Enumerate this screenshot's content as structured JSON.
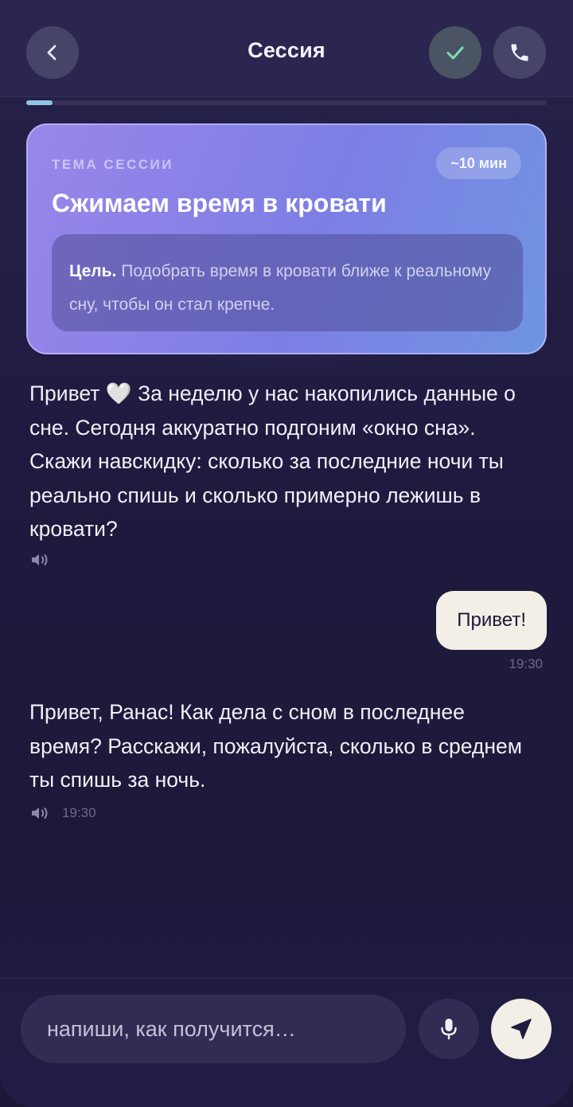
{
  "header": {
    "title": "Сессия",
    "back_icon": "chevron-left-icon",
    "done_icon": "check-icon",
    "call_icon": "phone-icon",
    "done_icon_color": "#7ee0b0"
  },
  "progress": {
    "value": 0.05,
    "color": "#8fc6e6"
  },
  "topic": {
    "label": "ТЕМА СЕССИИ",
    "duration": "~10 мин",
    "title": "Сжимаем время в кровати",
    "goal_label": "Цель.",
    "goal_text": "Подобрать время в кровати ближе к реальному сну, чтобы он стал крепче."
  },
  "messages": [
    {
      "from": "bot",
      "text_before_emoji": "Привет",
      "emoji": "🤍",
      "text_after_emoji": "За неделю у нас накопились данные о сне. Сегодня аккуратно подгоним «окно сна». Скажи навскидку: сколько за последние ночи ты реально спишь и сколько примерно лежишь в кровати?",
      "icon": "speaker-icon",
      "time": ""
    },
    {
      "from": "user",
      "text": "Привет!",
      "time": "19:30"
    },
    {
      "from": "bot",
      "text": "Привет, Ранас! Как дела с сном в последнее время? Расскажи, пожалуйста, сколько в среднем ты спишь за ночь.",
      "icon": "speaker-icon",
      "time": "19:30"
    }
  ],
  "composer": {
    "placeholder": "напиши, как получится…",
    "value": "",
    "mic_icon": "microphone-icon",
    "send_icon": "send-icon"
  }
}
